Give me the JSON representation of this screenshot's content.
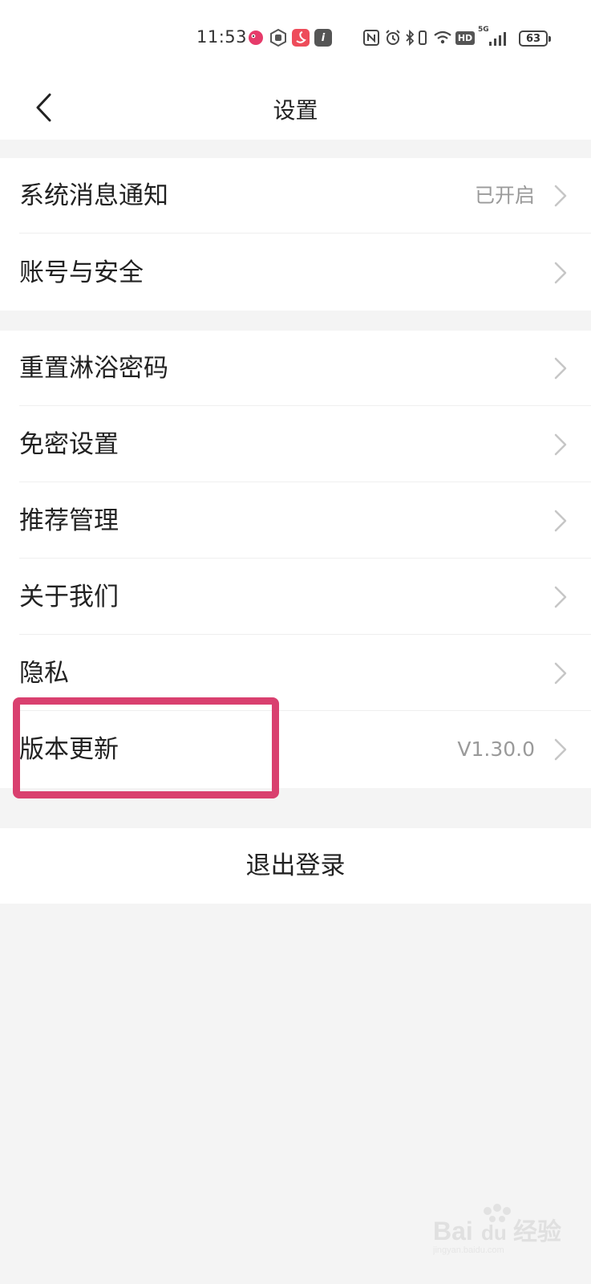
{
  "status_bar": {
    "time": "11:53",
    "signal_label": "5G",
    "hd_label": "HD",
    "battery": "63",
    "icons": [
      "app-icon-bird",
      "app-icon-hand",
      "app-icon-swan",
      "app-icon-info",
      "nfc-icon",
      "alarm-icon",
      "bluetooth-icon",
      "vibrate-icon",
      "wifi-icon",
      "hd-icon",
      "signal-icon",
      "battery-icon"
    ]
  },
  "navbar": {
    "title": "设置",
    "back_icon": "chevron-left-icon"
  },
  "group1": {
    "items": [
      {
        "label": "系统消息通知",
        "value": "已开启"
      },
      {
        "label": "账号与安全",
        "value": ""
      }
    ]
  },
  "group2": {
    "items": [
      {
        "label": "重置淋浴密码",
        "value": ""
      },
      {
        "label": "免密设置",
        "value": ""
      },
      {
        "label": "推荐管理",
        "value": ""
      },
      {
        "label": "关于我们",
        "value": ""
      },
      {
        "label": "隐私",
        "value": ""
      },
      {
        "label": "版本更新",
        "value": "V1.30.0"
      }
    ]
  },
  "logout": {
    "label": "退出登录"
  },
  "colors": {
    "highlight": "#d9406f",
    "background": "#f4f4f4",
    "card": "#ffffff",
    "secondary_text": "#9a9a9a"
  },
  "watermark": {
    "brand": "Bai",
    "brand2": "du",
    "text": "经验",
    "url": "jingyan.baidu.com"
  }
}
